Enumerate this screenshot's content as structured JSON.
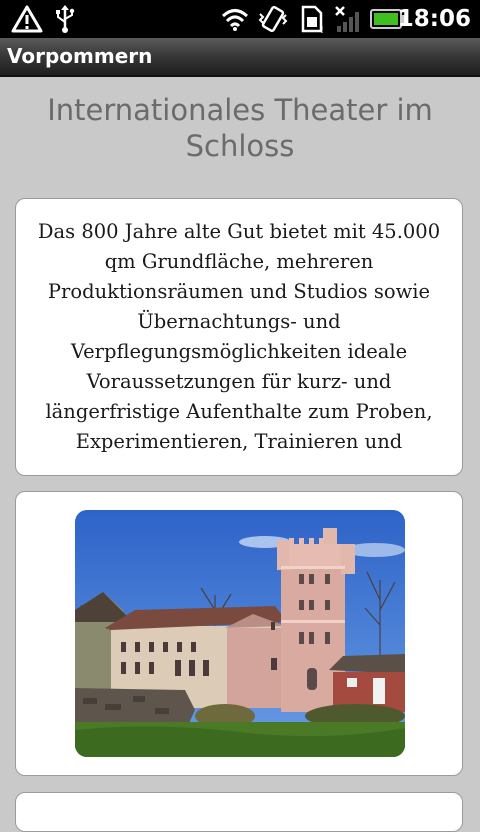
{
  "status_bar": {
    "time": "18:06",
    "icons": [
      "warning-icon",
      "usb-icon",
      "wifi-icon",
      "vibrate-icon",
      "sim-icon",
      "signal-icon",
      "battery-icon"
    ],
    "battery_color": "#3fbf1f"
  },
  "app_bar": {
    "title": "Vorpommern"
  },
  "main": {
    "heading": "Internationales Theater im Schloss",
    "description": "Das 800 Jahre alte Gut bietet mit 45.000 qm Grundfläche, mehreren Produktionsräumen und Studios sowie Übernachtungs- und Verpflegungsmöglichkeiten ideale Voraussetzungen für kurz- und längerfristige Aufenthalte zum Proben, Experimentieren, Trainieren und"
  }
}
